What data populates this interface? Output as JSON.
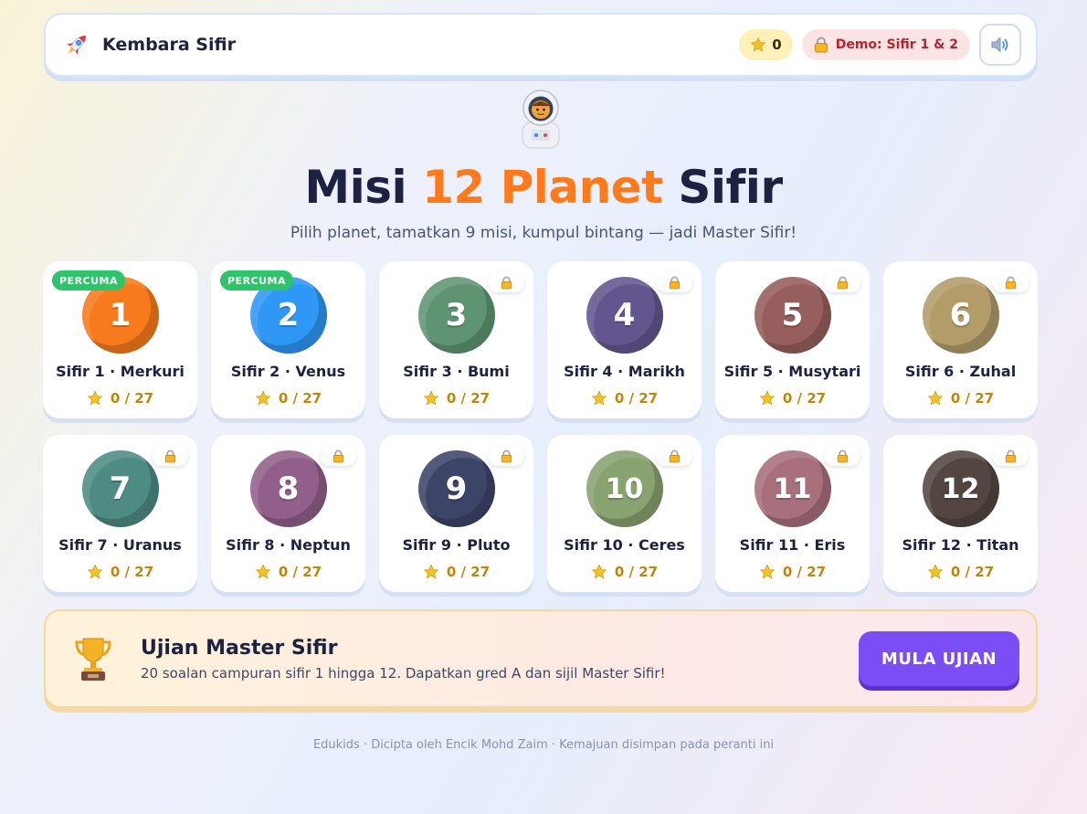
{
  "header": {
    "brand_name": "Kembara Sifir",
    "brand_icon": "rocket-icon",
    "stars_count": "0",
    "demo_label": "Demo: Sifir 1 & 2",
    "sound_icon": "speaker-icon"
  },
  "hero": {
    "title_pre": "Misi ",
    "title_accent": "12 Planet",
    "title_post": " Sifir",
    "subtitle": "Pilih planet, tamatkan 9 misi, kumpul bintang — jadi Master Sifir!",
    "mascot_icon": "astronaut-icon"
  },
  "planets": [
    {
      "number": "1",
      "title": "Sifir 1 · Merkuri",
      "score": "0 / 27",
      "color": "#f77a1c",
      "free_label": "PERCUMA",
      "locked": false
    },
    {
      "number": "2",
      "title": "Sifir 2 · Venus",
      "score": "0 / 27",
      "color": "#2f97f5",
      "free_label": "PERCUMA",
      "locked": false
    },
    {
      "number": "3",
      "title": "Sifir 3 · Bumi",
      "score": "0 / 27",
      "color": "#5f9472",
      "locked": true
    },
    {
      "number": "4",
      "title": "Sifir 4 · Marikh",
      "score": "0 / 27",
      "color": "#63568f",
      "locked": true
    },
    {
      "number": "5",
      "title": "Sifir 5 · Musytari",
      "score": "0 / 27",
      "color": "#965e5c",
      "locked": true
    },
    {
      "number": "6",
      "title": "Sifir 6 · Zuhal",
      "score": "0 / 27",
      "color": "#b29c68",
      "locked": true
    },
    {
      "number": "7",
      "title": "Sifir 7 · Uranus",
      "score": "0 / 27",
      "color": "#4d8b83",
      "locked": true
    },
    {
      "number": "8",
      "title": "Sifir 8 · Neptun",
      "score": "0 / 27",
      "color": "#925f8a",
      "locked": true
    },
    {
      "number": "9",
      "title": "Sifir 9 · Pluto",
      "score": "0 / 27",
      "color": "#3c4468",
      "locked": true
    },
    {
      "number": "10",
      "title": "Sifir 10 · Ceres",
      "score": "0 / 27",
      "color": "#88a270",
      "locked": true
    },
    {
      "number": "11",
      "title": "Sifir 11 · Eris",
      "score": "0 / 27",
      "color": "#a86f7c",
      "locked": true
    },
    {
      "number": "12",
      "title": "Sifir 12 · Titan",
      "score": "0 / 27",
      "color": "#534640",
      "locked": true
    }
  ],
  "exam": {
    "title": "Ujian Master Sifir",
    "description": "20 soalan campuran sifir 1 hingga 12. Dapatkan gred A dan sijil Master Sifir!",
    "button_label": "MULA UJIAN",
    "icon": "trophy-icon"
  },
  "footer": {
    "text": "Edukids · Dicipta oleh Encik Mohd Zaim · Kemajuan disimpan pada peranti ini"
  }
}
